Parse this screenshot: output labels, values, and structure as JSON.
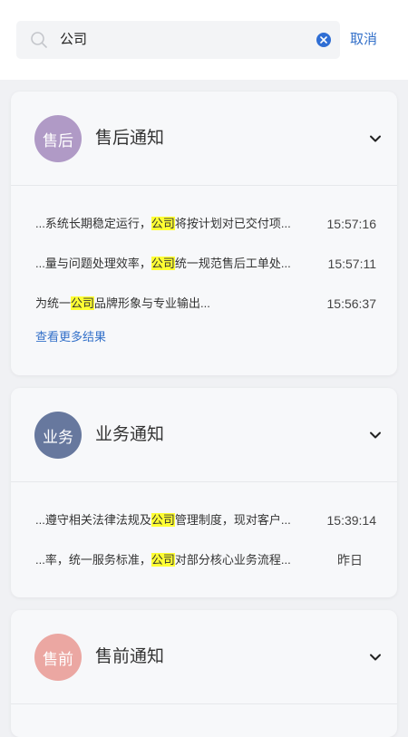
{
  "search": {
    "query": "公司",
    "cancel_label": "取消"
  },
  "groups": [
    {
      "avatar_text": "售后",
      "avatar_color": "#b09ac6",
      "title": "售后通知",
      "results": [
        {
          "pre": "...系统长期稳定运行，",
          "match": "公司",
          "post": "将按计划对已交付项...",
          "time": "15:57:16"
        },
        {
          "pre": "...量与问题处理效率，",
          "match": "公司",
          "post": "统一规范售后工单处...",
          "time": "15:57:11"
        },
        {
          "pre": "为统一",
          "match": "公司",
          "post": "品牌形象与专业输出...",
          "time": "15:56:37"
        }
      ],
      "more_label": "查看更多结果"
    },
    {
      "avatar_text": "业务",
      "avatar_color": "#67789e",
      "title": "业务通知",
      "results": [
        {
          "pre": "...遵守相关法律法规及",
          "match": "公司",
          "post": "管理制度，现对客户...",
          "time": "15:39:14"
        },
        {
          "pre": "...率，统一服务标准，",
          "match": "公司",
          "post": "对部分核心业务流程...",
          "time": "昨日"
        }
      ]
    },
    {
      "avatar_text": "售前",
      "avatar_color": "#eba7a2",
      "title": "售前通知",
      "results": []
    }
  ]
}
